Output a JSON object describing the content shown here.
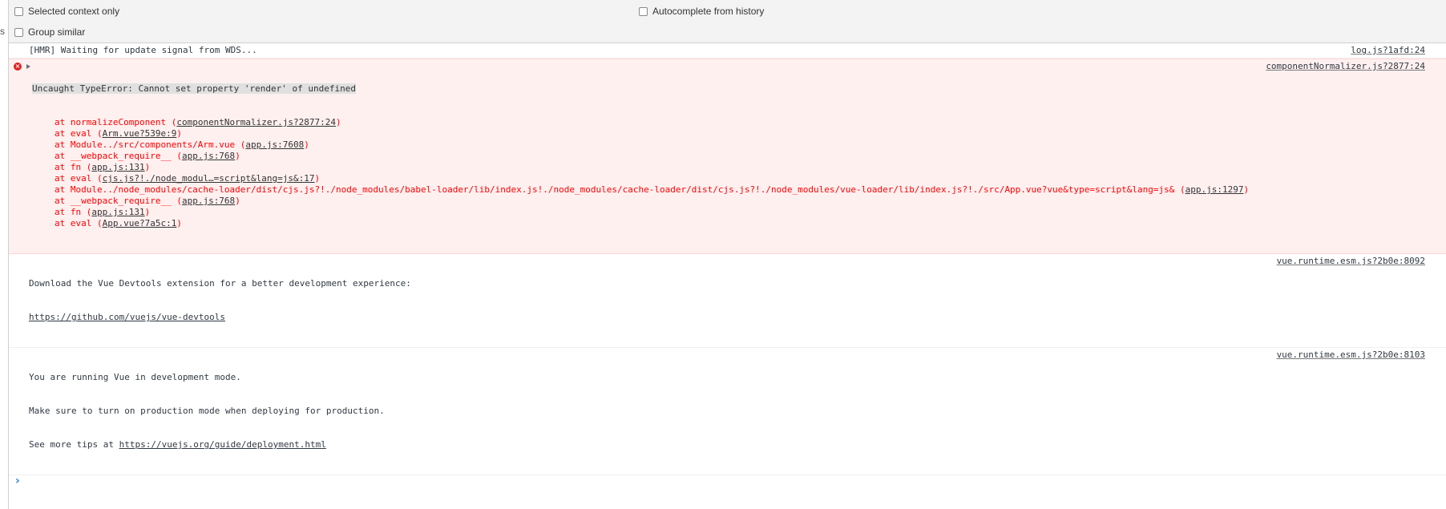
{
  "sidebar_edge": {
    "char": "s"
  },
  "settings": {
    "selected_context_only": "Selected context only",
    "autocomplete_from_history": "Autocomplete from history",
    "group_similar": "Group similar"
  },
  "messages": {
    "hmr": {
      "text": "[HMR] Waiting for update signal from WDS...",
      "source": "log.js?1afd:24"
    },
    "error": {
      "title": "Uncaught TypeError: Cannot set property 'render' of undefined",
      "source": "componentNormalizer.js?2877:24",
      "frames": [
        {
          "text": "at normalizeComponent (",
          "link": "componentNormalizer.js?2877:24",
          "end": ")"
        },
        {
          "text": "at eval (",
          "link": "Arm.vue?539e:9",
          "end": ")"
        },
        {
          "text": "at Module../src/components/Arm.vue (",
          "link": "app.js:7608",
          "end": ")"
        },
        {
          "text": "at __webpack_require__ (",
          "link": "app.js:768",
          "end": ")"
        },
        {
          "text": "at fn (",
          "link": "app.js:131",
          "end": ")"
        },
        {
          "text": "at eval (",
          "link": "cjs.js?!./node_modul…=script&lang=js&:17",
          "end": ")"
        },
        {
          "text": "at Module../node_modules/cache-loader/dist/cjs.js?!./node_modules/babel-loader/lib/index.js!./node_modules/cache-loader/dist/cjs.js?!./node_modules/vue-loader/lib/index.js?!./src/App.vue?vue&type=script&lang=js& (",
          "link": "app.js:1297",
          "end": ")"
        },
        {
          "text": "at __webpack_require__ (",
          "link": "app.js:768",
          "end": ")"
        },
        {
          "text": "at fn (",
          "link": "app.js:131",
          "end": ")"
        },
        {
          "text": "at eval (",
          "link": "App.vue?7a5c:1",
          "end": ")"
        }
      ]
    },
    "devtools": {
      "line1": "Download the Vue Devtools extension for a better development experience:",
      "link": "https://github.com/vuejs/vue-devtools",
      "source": "vue.runtime.esm.js?2b0e:8092"
    },
    "devmode": {
      "line1": "You are running Vue in development mode.",
      "line2": "Make sure to turn on production mode when deploying for production.",
      "line3_prefix": "See more tips at ",
      "link": "https://vuejs.org/guide/deployment.html",
      "source": "vue.runtime.esm.js?2b0e:8103"
    }
  },
  "prompt": {
    "symbol": "›"
  },
  "colors": {
    "error_text": "#ff0000",
    "error_bg": "#fff0f0",
    "prompt": "#367cf1"
  }
}
